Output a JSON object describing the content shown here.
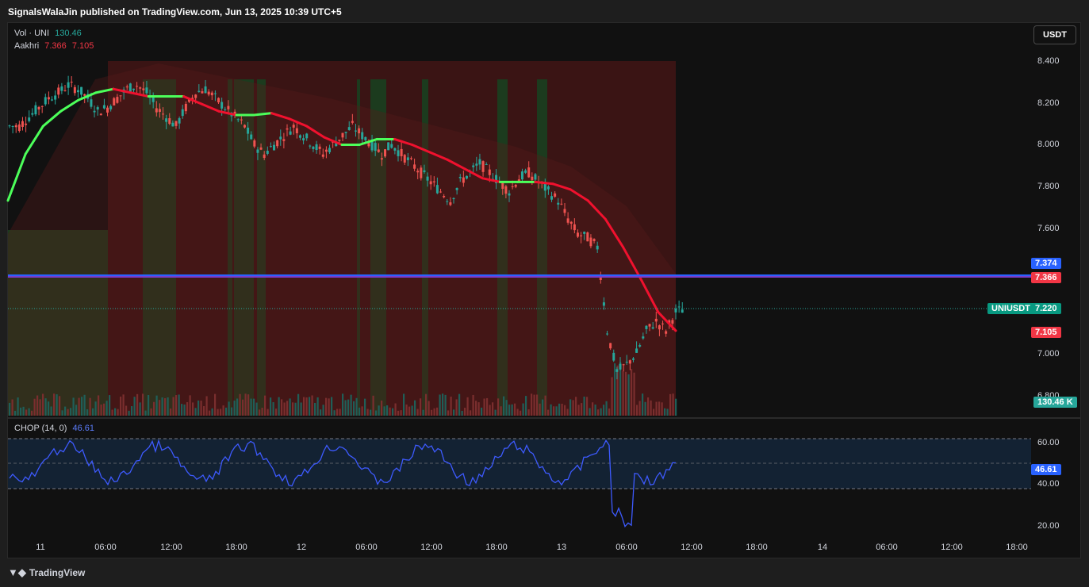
{
  "header": {
    "publish_text": "SignalsWalaJin published on TradingView.com, Jun 13, 2025 10:39 UTC+5"
  },
  "currency": "USDT",
  "legend": {
    "vol_label": "Vol · UNI",
    "vol_value": "130.46",
    "aakhri_label": "Aakhri",
    "aakhri_v1": "7.366",
    "aakhri_v2": "7.105"
  },
  "chop": {
    "label": "CHOP (14, 0)",
    "value": "46.61"
  },
  "price_axis": [
    "8.400",
    "8.200",
    "8.000",
    "7.800",
    "7.600",
    "7.000",
    "6.800"
  ],
  "chop_axis": [
    "60.00",
    "40.00",
    "20.00"
  ],
  "tags": {
    "blue_line": "7.374",
    "red_line": "7.366",
    "symbol": "UNIUSDT",
    "last_price": "7.220",
    "lower_band": "7.105",
    "volume": "130.46 K",
    "chop_value": "46.61"
  },
  "time_axis": [
    "11",
    "06:00",
    "12:00",
    "18:00",
    "12",
    "06:00",
    "12:00",
    "18:00",
    "13",
    "06:00",
    "12:00",
    "18:00",
    "14",
    "06:00",
    "12:00",
    "18:00"
  ],
  "footer": {
    "brand": "TradingView"
  },
  "colors": {
    "bull": "#26a69a",
    "bear": "#ef5350",
    "blue_line": "#2962ff",
    "red_line": "#f23645",
    "chop_line": "#3d5afe"
  },
  "chart_data": {
    "type": "line",
    "series": [
      {
        "values": [
          8.2,
          8.25,
          8.3,
          8.35,
          8.38,
          8.42,
          8.4,
          8.35,
          8.28,
          8.3,
          8.35,
          8.4,
          8.42,
          8.38,
          8.3,
          8.25,
          8.2,
          8.3,
          8.38,
          8.4,
          8.35,
          8.3,
          8.25,
          8.2,
          8.1,
          8.05,
          8.1,
          8.15,
          8.2,
          8.15,
          8.1,
          8.05,
          8.1,
          8.15,
          8.2,
          8.15,
          8.1,
          8.05,
          8.1,
          8.05,
          8.0,
          7.95,
          7.9,
          7.85,
          7.8,
          7.9,
          7.95,
          8.0,
          7.95,
          7.9,
          7.85,
          7.92,
          7.95,
          7.9,
          7.85,
          7.8,
          7.7,
          7.62,
          7.6,
          7.55,
          7.1,
          6.88,
          6.92,
          6.98,
          7.1,
          7.15,
          7.1,
          7.2,
          7.22
        ]
      },
      {
        "values": [
          7.8,
          8.05,
          8.2,
          8.28,
          8.34,
          8.38,
          8.4,
          8.38,
          8.36,
          8.36,
          8.36,
          8.32,
          8.28,
          8.26,
          8.26,
          8.27,
          8.24,
          8.2,
          8.14,
          8.1,
          8.1,
          8.13,
          8.13,
          8.1,
          8.06,
          8.02,
          7.97,
          7.92,
          7.9,
          7.9,
          7.9,
          7.89,
          7.86,
          7.8,
          7.7,
          7.55,
          7.38,
          7.2,
          7.1
        ]
      }
    ],
    "ylim": [
      6.75,
      8.55
    ]
  }
}
